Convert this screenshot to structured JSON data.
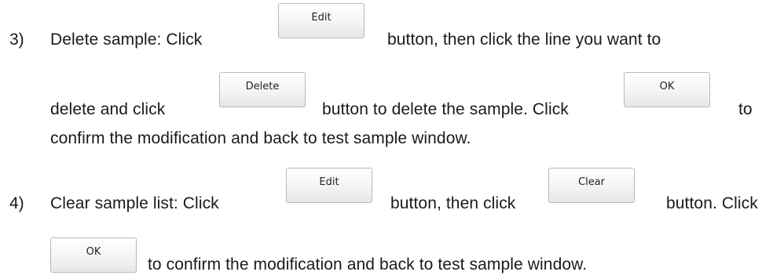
{
  "items": [
    {
      "number": "3)",
      "line1_a": "Delete sample: Click",
      "line1_b": "button, then click the line you want to",
      "line2_a": "delete and click",
      "line2_b": "button to delete the sample. Click",
      "line2_c": "to",
      "line3": "confirm the modification and back to test sample window."
    },
    {
      "number": "4)",
      "line1_a": "Clear sample list: Click",
      "line1_b": "button, then click",
      "line1_c": "button. Click",
      "line2": "to confirm the modification and back to test sample window."
    }
  ],
  "buttons": {
    "edit": "Edit",
    "delete": "Delete",
    "ok": "OK",
    "clear": "Clear"
  }
}
